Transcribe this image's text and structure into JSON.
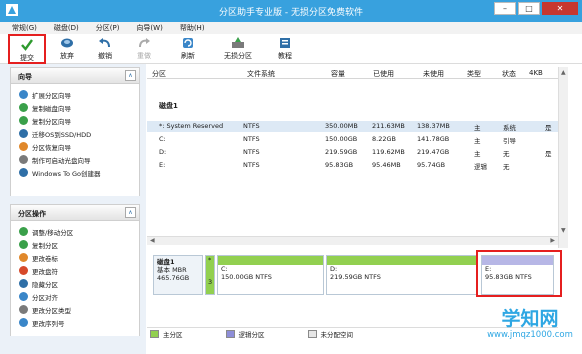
{
  "window": {
    "title": "分区助手专业版 - 无损分区免费软件",
    "min_label": "–",
    "max_label": "□",
    "close_label": "✕"
  },
  "menu": [
    "常规(G)",
    "磁盘(D)",
    "分区(P)",
    "向导(W)",
    "帮助(H)"
  ],
  "toolbar": {
    "commit": "提交",
    "discard": "放弃",
    "undo": "撤销",
    "redo": "重做",
    "refresh": "刷新",
    "lossless": "无损分区",
    "tutorial": "教程"
  },
  "wizard_panel": {
    "title": "向导",
    "collapse": "∧",
    "items": [
      {
        "label": "扩展分区向导",
        "icon": "extend-partition-icon",
        "color": "#3a86c8"
      },
      {
        "label": "复制磁盘向导",
        "icon": "copy-disk-icon",
        "color": "#3aa04a"
      },
      {
        "label": "复制分区向导",
        "icon": "copy-partition-icon",
        "color": "#3aa04a"
      },
      {
        "label": "迁移OS到SSD/HDD",
        "icon": "migrate-os-icon",
        "color": "#2f6fa7"
      },
      {
        "label": "分区恢复向导",
        "icon": "partition-recovery-icon",
        "color": "#e0882b"
      },
      {
        "label": "制作可启动光盘向导",
        "icon": "bootable-disc-icon",
        "color": "#7a7a7a"
      },
      {
        "label": "Windows To Go创建器",
        "icon": "windows-to-go-icon",
        "color": "#2f6fa7"
      }
    ]
  },
  "ops_panel": {
    "title": "分区操作",
    "collapse": "∧",
    "items": [
      {
        "label": "调整/移动分区",
        "icon": "resize-partition-icon",
        "color": "#3aa04a"
      },
      {
        "label": "复制分区",
        "icon": "copy-icon",
        "color": "#3aa04a"
      },
      {
        "label": "更改卷标",
        "icon": "label-icon",
        "color": "#e0882b"
      },
      {
        "label": "更改盘符",
        "icon": "drive-letter-icon",
        "color": "#d64a2b"
      },
      {
        "label": "隐藏分区",
        "icon": "hide-icon",
        "color": "#2f6fa7"
      },
      {
        "label": "分区对齐",
        "icon": "align-icon",
        "color": "#3a86c8"
      },
      {
        "label": "更改分区类型",
        "icon": "change-type-icon",
        "color": "#7a7a7a"
      },
      {
        "label": "更改序列号",
        "icon": "serial-icon",
        "color": "#3a86c8"
      }
    ]
  },
  "table": {
    "columns": [
      "分区",
      "文件系统",
      "容量",
      "已使用",
      "未使用",
      "类型",
      "状态",
      "4KB"
    ],
    "disk_header": "磁盘1",
    "rows": [
      {
        "partition": "*: System Reserved",
        "fs": "NTFS",
        "capacity": "350.00MB",
        "used": "211.63MB",
        "free": "138.37MB",
        "type": "主",
        "status": "系统",
        "align": "是"
      },
      {
        "partition": "C:",
        "fs": "NTFS",
        "capacity": "150.00GB",
        "used": "8.22GB",
        "free": "141.78GB",
        "type": "主",
        "status": "引导",
        "align": ""
      },
      {
        "partition": "D:",
        "fs": "NTFS",
        "capacity": "219.59GB",
        "used": "119.62MB",
        "free": "219.47GB",
        "type": "主",
        "status": "无",
        "align": "是"
      },
      {
        "partition": "E:",
        "fs": "NTFS",
        "capacity": "95.83GB",
        "used": "95.46MB",
        "free": "95.74GB",
        "type": "逻辑",
        "status": "无",
        "align": ""
      }
    ]
  },
  "disk_map": {
    "disk_name": "磁盘1",
    "disk_type": "基本 MBR",
    "disk_size": "465.76GB",
    "small_part_label": "*",
    "small_part_num": "3",
    "partitions": [
      {
        "name": "C:",
        "detail": "150.00GB NTFS",
        "bar_color": "#92d050"
      },
      {
        "name": "D:",
        "detail": "219.59GB NTFS",
        "bar_color": "#92d050"
      },
      {
        "name": "E:",
        "detail": "95.83GB NTFS",
        "bar_color": "#b7b7e6"
      }
    ]
  },
  "legend": {
    "primary": "主分区",
    "logical": "逻辑分区",
    "unallocated": "未分配空间",
    "primary_color": "#92d050",
    "logical_color": "#8e8ed8",
    "unallocated_color": "#e6e6e6"
  },
  "watermark": {
    "brand": "学知网",
    "url": "www.jmqz1000.com"
  },
  "colors": {
    "titlebar": "#38a1de",
    "highlight": "#e51f1f",
    "selected_row": "#dde9f5"
  }
}
